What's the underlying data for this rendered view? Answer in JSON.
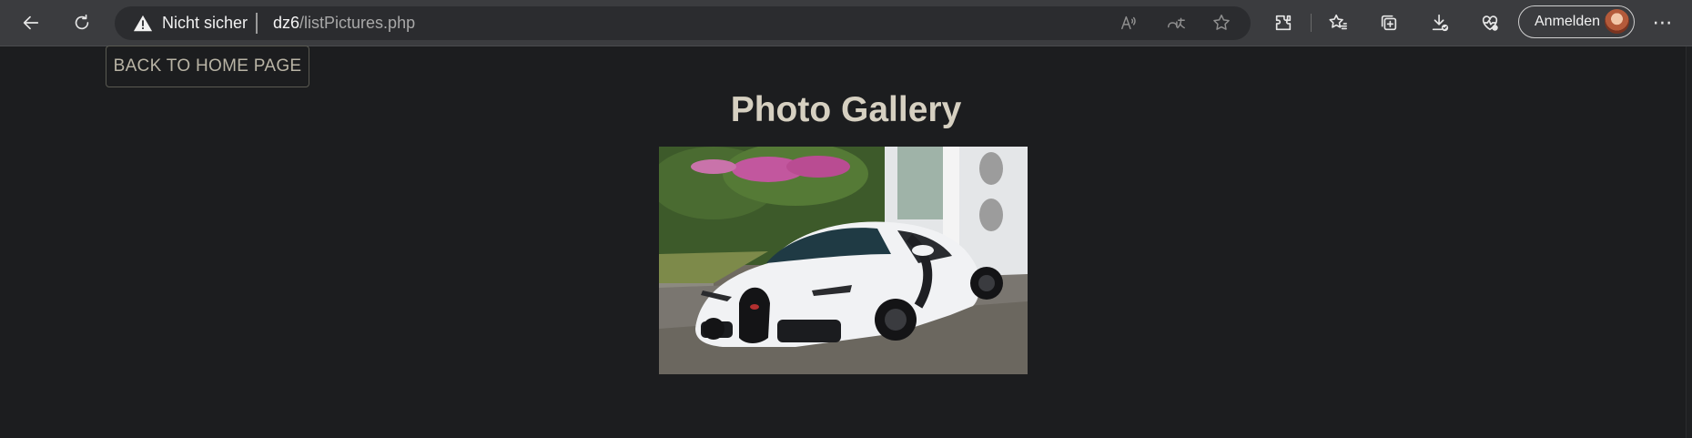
{
  "browser": {
    "security_label": "Nicht sicher",
    "url_host": "dz6",
    "url_path": "/listPictures.php",
    "signin_label": "Anmelden",
    "icons": [
      "back-arrow-icon",
      "reload-icon",
      "warning-icon",
      "read-aloud-icon",
      "translate-icon",
      "favorite-star-icon",
      "extensions-icon",
      "favorites-icon",
      "collections-icon",
      "downloads-icon",
      "browser-essentials-icon",
      "more-icon"
    ]
  },
  "page": {
    "back_button_label": "BACK TO HOME PAGE",
    "title": "Photo Gallery",
    "photos": [
      {
        "alt": "White Bugatti sports car"
      }
    ]
  },
  "colors": {
    "page_background": "#1c1d1f",
    "title_color": "#d6d0c1",
    "button_text": "#b9b4a5",
    "toolbar_background": "#3b3c3f"
  }
}
